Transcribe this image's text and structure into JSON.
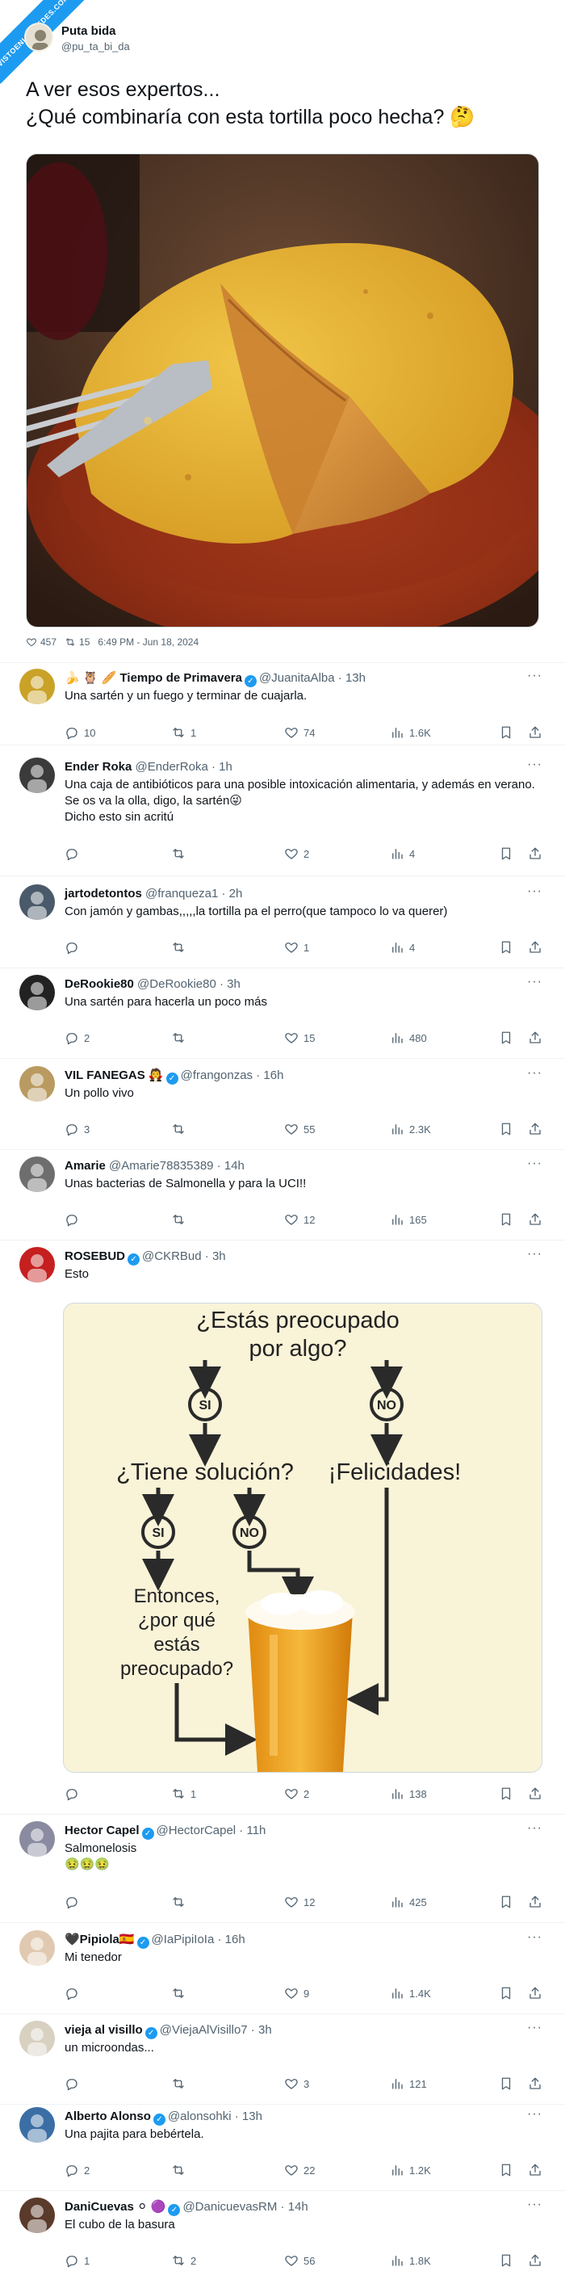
{
  "badge": "VISTOENLASREDES.COM",
  "tweet": {
    "author_name": "Puta bida",
    "author_handle": "@pu_ta_bi_da",
    "text_line1": "A ver esos expertos...",
    "text_line2": "¿Qué combinaría con esta tortilla poco hecha? 🤔",
    "likes": "457",
    "retweets": "15",
    "timestamp": "6:49 PM - Jun 18, 2024"
  },
  "replies": [
    {
      "name": "🍌 🦉 🥖 Tiempo de Primavera",
      "verified": true,
      "handle": "@JuanitaAlba",
      "time": "13h",
      "text": "Una sartén y un fuego y terminar de cuajarla.",
      "replies": "10",
      "retweets": "1",
      "likes": "74",
      "views": "1.6K"
    },
    {
      "name": "Ender Roka",
      "verified": false,
      "handle": "@EnderRoka",
      "time": "1h",
      "text": "Una caja de antibióticos para una posible intoxicación alimentaria, y además en verano. Se os va la olla, digo, la sartén😜",
      "text2": "Dicho esto sin acritú",
      "replies": "",
      "retweets": "",
      "likes": "2",
      "views": "4"
    },
    {
      "name": "jartodetontos",
      "verified": false,
      "handle": "@franqueza1",
      "time": "2h",
      "text": "Con jamón y gambas,,,,,la tortilla pa el perro(que tampoco lo va querer)",
      "replies": "",
      "retweets": "",
      "likes": "1",
      "views": "4"
    },
    {
      "name": "DeRookie80",
      "verified": false,
      "handle": "@DeRookie80",
      "time": "3h",
      "text": "Una sartén para hacerla un poco más",
      "replies": "2",
      "retweets": "",
      "likes": "15",
      "views": "480"
    },
    {
      "name": "VIL FANEGAS 🧛",
      "verified": true,
      "handle": "@frangonzas",
      "time": "16h",
      "text": "Un pollo vivo",
      "replies": "3",
      "retweets": "",
      "likes": "55",
      "views": "2.3K"
    },
    {
      "name": "Amarie",
      "verified": false,
      "handle": "@Amarie78835389",
      "time": "14h",
      "text": "Unas bacterias de Salmonella y para la UCI!!",
      "replies": "",
      "retweets": "",
      "likes": "12",
      "views": "165"
    },
    {
      "name": "ROSEBUD",
      "verified": true,
      "handle": "@CKRBud",
      "time": "3h",
      "text": "Esto",
      "replies": "",
      "retweets": "1",
      "likes": "2",
      "views": "138"
    },
    {
      "name": "Hector Capel",
      "verified": true,
      "handle": "@HectorCapel",
      "time": "11h",
      "text": "Salmonelosis",
      "text2": "🤢🤢🤢",
      "replies": "",
      "retweets": "",
      "likes": "12",
      "views": "425"
    },
    {
      "name": "🖤Pipiola🇪🇸",
      "verified": true,
      "handle": "@IaPipiIoIa",
      "time": "16h",
      "text": "Mi tenedor",
      "replies": "",
      "retweets": "",
      "likes": "9",
      "views": "1.4K"
    },
    {
      "name": "vieja al visillo",
      "verified": true,
      "handle": "@ViejaAlVisillo7",
      "time": "3h",
      "text": "un microondas...",
      "replies": "",
      "retweets": "",
      "likes": "3",
      "views": "121"
    },
    {
      "name": "Alberto Alonso",
      "verified": true,
      "handle": "@alonsohki",
      "time": "13h",
      "text": "Una pajita para bebértela.",
      "replies": "2",
      "retweets": "",
      "likes": "22",
      "views": "1.2K"
    },
    {
      "name": "DaniCuevas ⚪ 🟣",
      "verified": true,
      "handle": "@DanicuevasRM",
      "time": "14h",
      "text": "El cubo de la basura",
      "replies": "1",
      "retweets": "2",
      "likes": "56",
      "views": "1.8K"
    }
  ],
  "flowchart": {
    "q1_line1": "¿Estás preocupado",
    "q1_line2": "por algo?",
    "si": "SI",
    "no": "NO",
    "q2": "¿Tiene solución?",
    "congrats": "¡Felicidades!",
    "then_line1": "Entonces,",
    "then_line2": "¿por qué",
    "then_line3": "estás",
    "then_line4": "preocupado?"
  }
}
